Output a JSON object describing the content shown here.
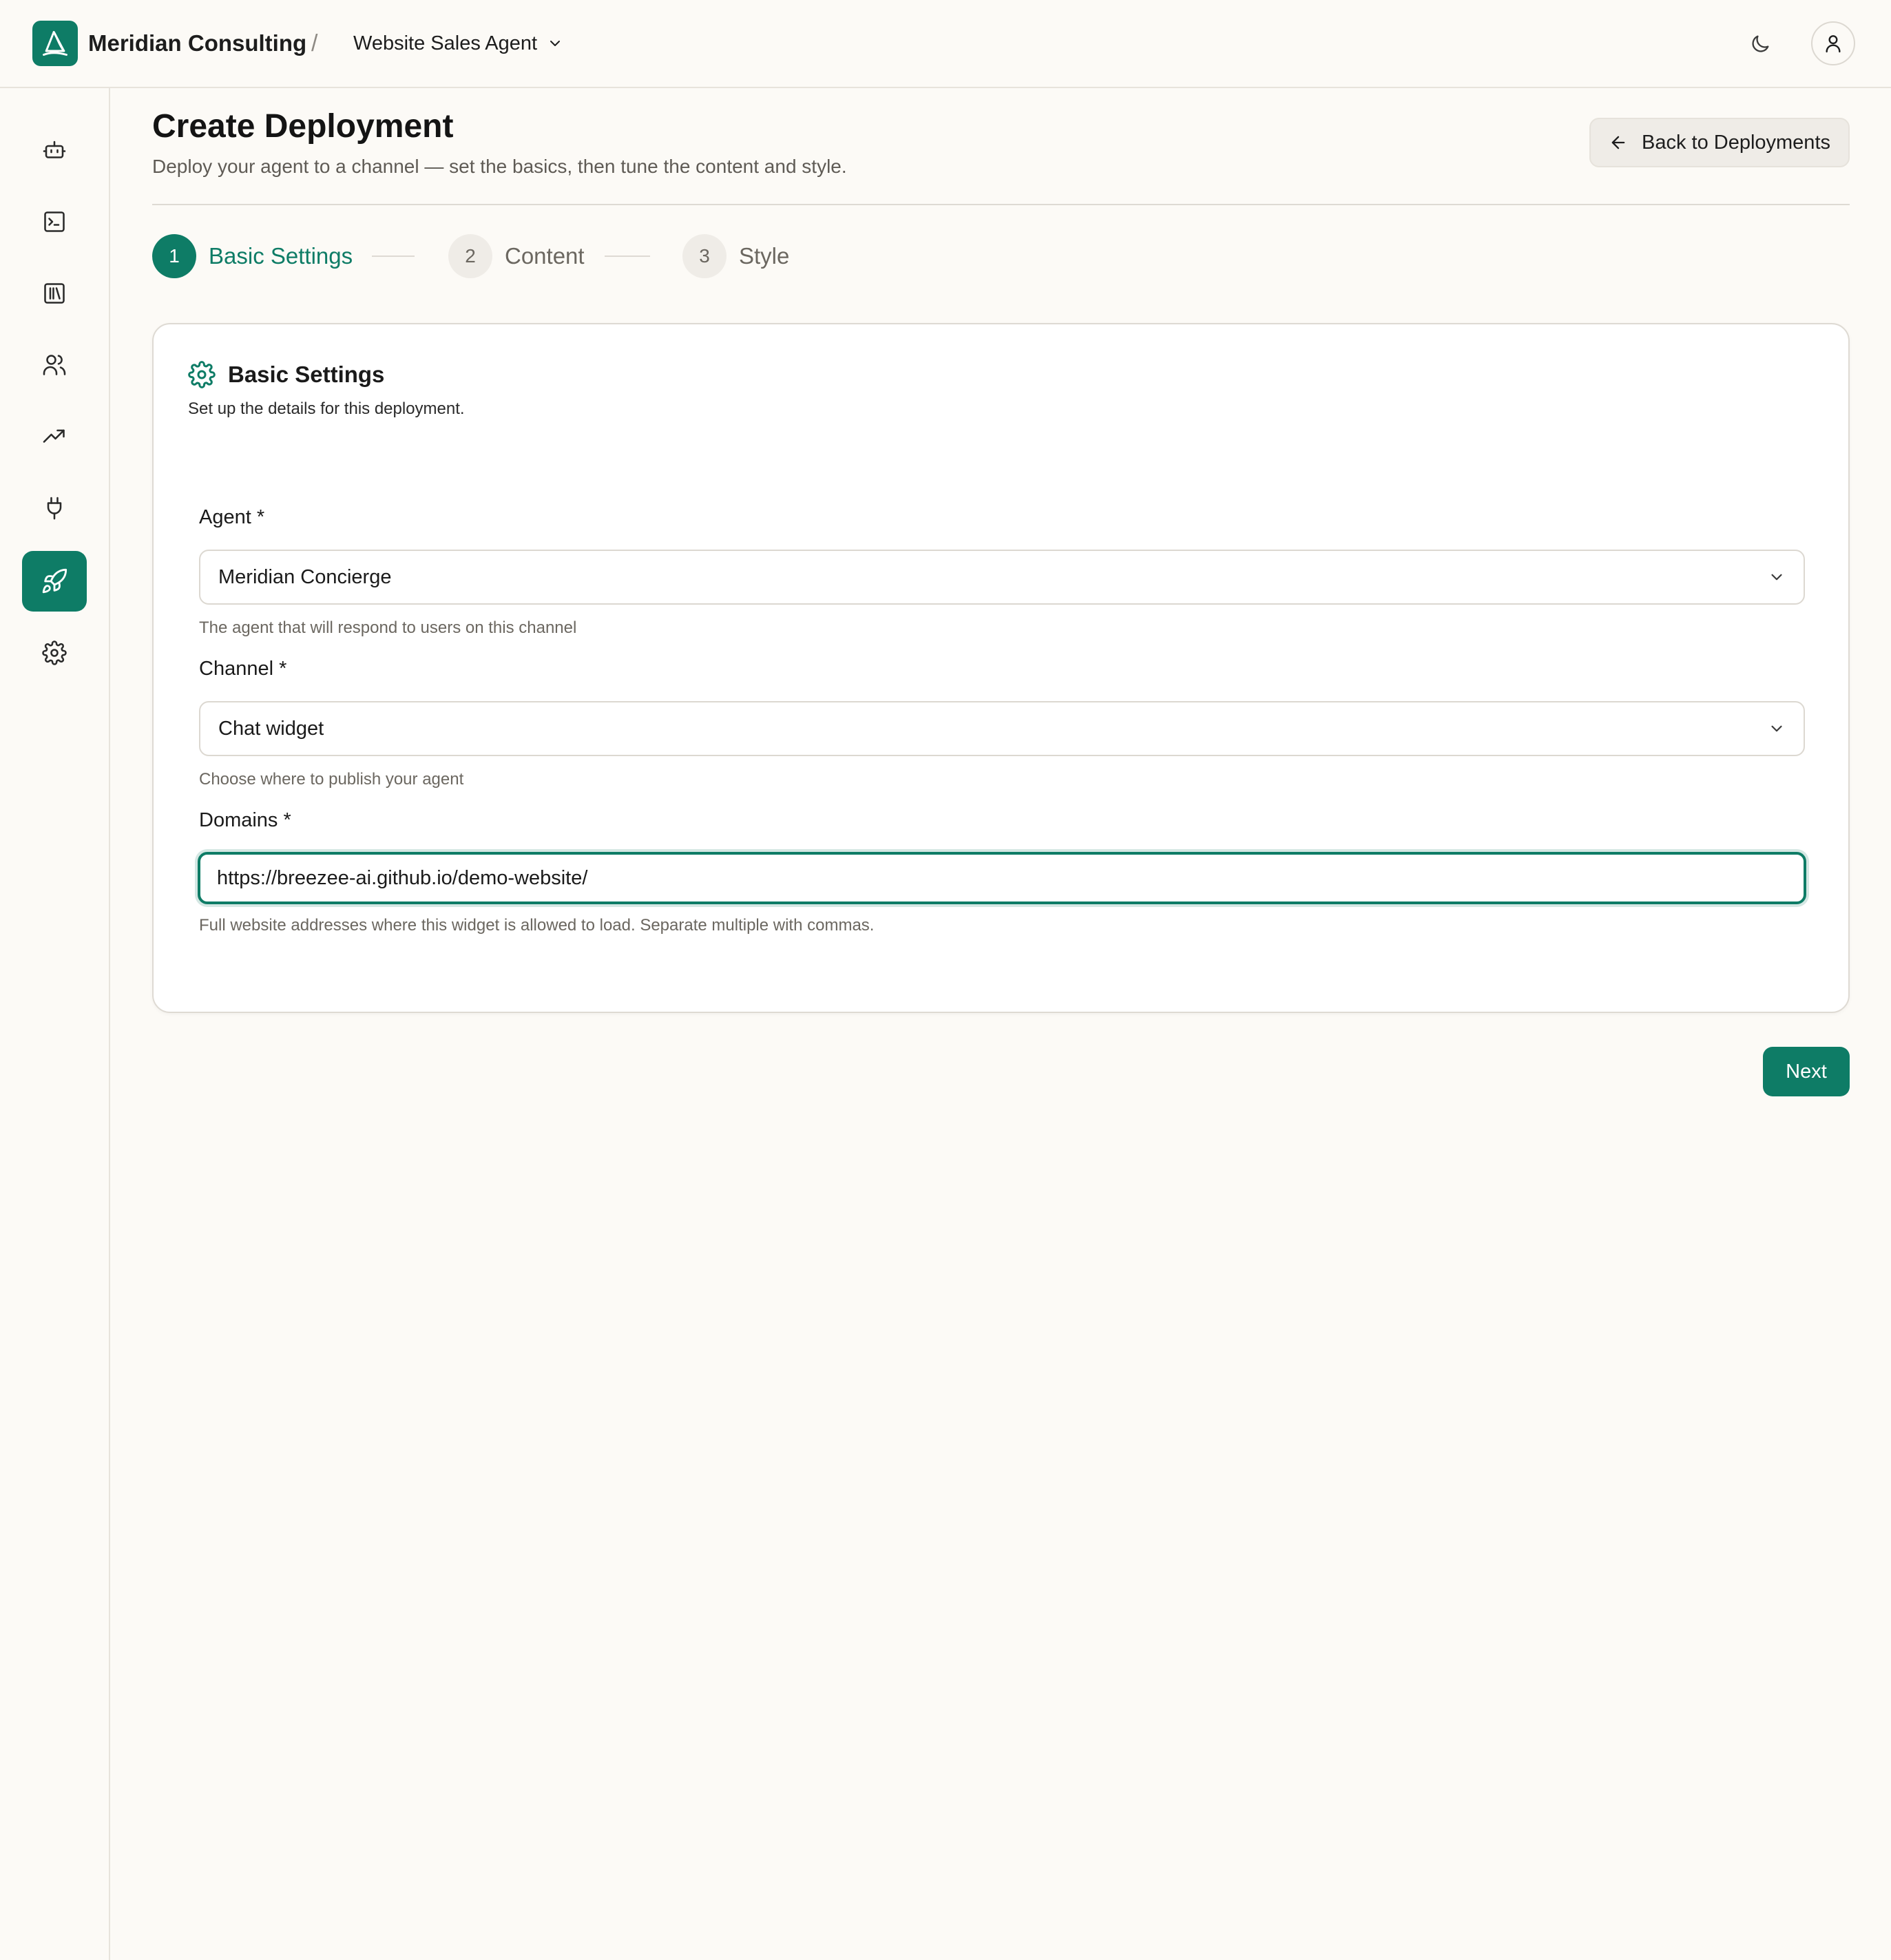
{
  "header": {
    "org_name": "Meridian Consulting",
    "separator": "/",
    "agent_switcher": "Website Sales Agent"
  },
  "sidebar": {
    "items": [
      {
        "icon": "bot-icon",
        "active": false
      },
      {
        "icon": "terminal-icon",
        "active": false
      },
      {
        "icon": "library-icon",
        "active": false
      },
      {
        "icon": "users-icon",
        "active": false
      },
      {
        "icon": "trending-up-icon",
        "active": false
      },
      {
        "icon": "plug-icon",
        "active": false
      },
      {
        "icon": "rocket-icon",
        "active": true
      },
      {
        "icon": "settings-icon",
        "active": false
      }
    ]
  },
  "page": {
    "title": "Create Deployment",
    "subtitle": "Deploy your agent to a channel — set the basics, then tune the content and style.",
    "back_button": "Back to Deployments"
  },
  "stepper": {
    "steps": [
      {
        "number": "1",
        "label": "Basic Settings",
        "active": true
      },
      {
        "number": "2",
        "label": "Content",
        "active": false
      },
      {
        "number": "3",
        "label": "Style",
        "active": false
      }
    ]
  },
  "form": {
    "title": "Basic Settings",
    "description": "Set up the details for this deployment.",
    "agent": {
      "label": "Agent *",
      "value": "Meridian Concierge",
      "hint": "The agent that will respond to users on this channel"
    },
    "channel": {
      "label": "Channel *",
      "value": "Chat widget",
      "hint": "Choose where to publish your agent"
    },
    "domains": {
      "label": "Domains *",
      "value": "https://breezee-ai.github.io/demo-website/",
      "hint": "Full website addresses where this widget is allowed to load. Separate multiple with commas."
    }
  },
  "actions": {
    "next": "Next"
  },
  "colors": {
    "accent": "#0e7c66",
    "background": "#fcfaf6",
    "border": "#dedad3"
  }
}
